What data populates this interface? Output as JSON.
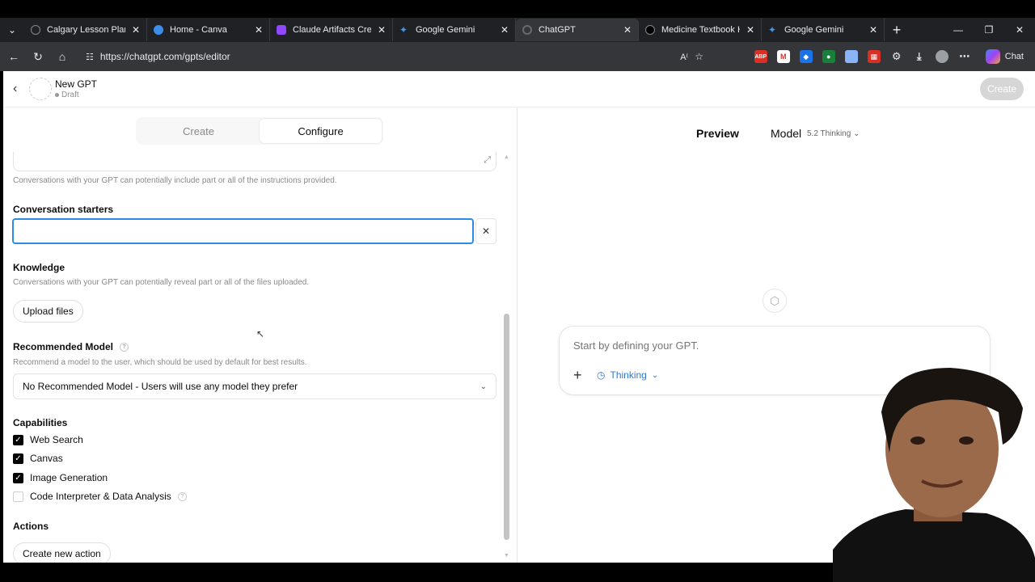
{
  "browser": {
    "tabs": [
      {
        "title": "Calgary Lesson Plan - N",
        "icon": "circle-icon",
        "color": "#555"
      },
      {
        "title": "Home - Canva",
        "icon": "canva-icon",
        "color": "#7d2ae8"
      },
      {
        "title": "Claude Artifacts Creatio",
        "icon": "shield-icon",
        "color": "#9146ff"
      },
      {
        "title": "Google Gemini",
        "icon": "gemini-icon",
        "color": "#4796e3"
      },
      {
        "title": "ChatGPT",
        "icon": "chatgpt-icon",
        "color": "#5a5a5a"
      },
      {
        "title": "Medicine Textbook Han",
        "icon": "openai-icon",
        "color": "#111"
      },
      {
        "title": "Google Gemini",
        "icon": "gemini-icon",
        "color": "#4796e3"
      }
    ],
    "active_tab": 4,
    "url": "https://chatgpt.com/gpts/editor",
    "chat_button": "Chat"
  },
  "header": {
    "name": "New GPT",
    "status": "Draft",
    "create_button": "Create"
  },
  "editor": {
    "tabs": [
      "Create",
      "Configure"
    ],
    "active_tab": "Configure",
    "instructions_note": "Conversations with your GPT can potentially include part or all of the instructions provided.",
    "conversation_starters": {
      "label": "Conversation starters",
      "value": ""
    },
    "knowledge": {
      "label": "Knowledge",
      "note": "Conversations with your GPT can potentially reveal part or all of the files uploaded.",
      "upload_button": "Upload files"
    },
    "recommended_model": {
      "label": "Recommended Model",
      "help": "?",
      "note": "Recommend a model to the user, which should be used by default for best results.",
      "selected": "No Recommended Model - Users will use any model they prefer"
    },
    "capabilities": {
      "label": "Capabilities",
      "items": [
        {
          "label": "Web Search",
          "checked": true
        },
        {
          "label": "Canvas",
          "checked": true
        },
        {
          "label": "Image Generation",
          "checked": true
        },
        {
          "label": "Code Interpreter & Data Analysis",
          "checked": false
        }
      ]
    },
    "actions": {
      "label": "Actions",
      "create_button": "Create new action"
    }
  },
  "preview": {
    "title": "Preview",
    "model_label": "Model",
    "model_version": "5.2 Thinking",
    "composer_placeholder": "Start by defining your GPT.",
    "thinking_label": "Thinking"
  }
}
